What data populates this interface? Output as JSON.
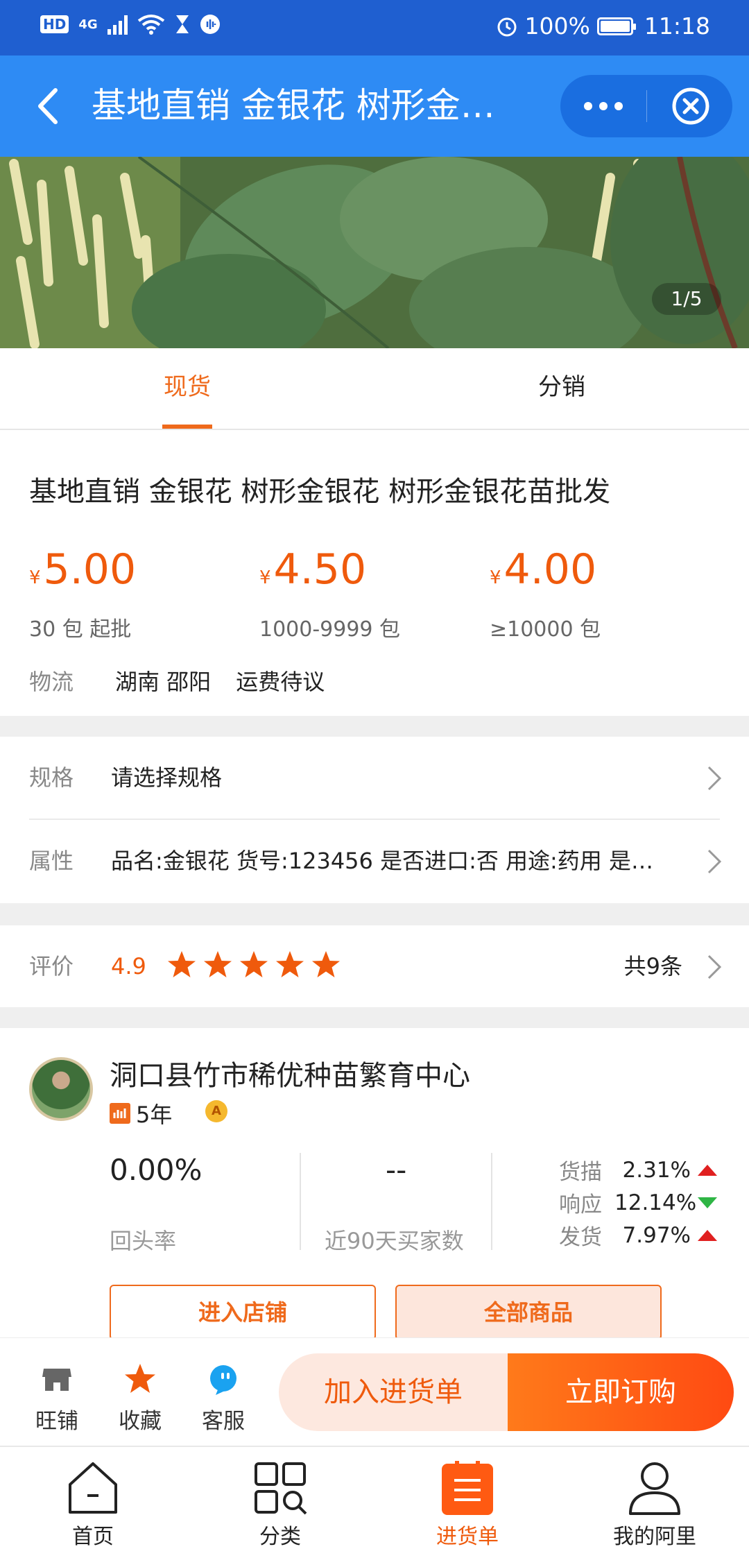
{
  "status_bar": {
    "badge": "HD",
    "network": "4G",
    "battery": "100%",
    "time": "11:18"
  },
  "header": {
    "title": "基地直销 金银花 树形金银花 树形金银花苗批发"
  },
  "gallery": {
    "counter": "1/5"
  },
  "tabs": [
    {
      "label": "现货",
      "active": true
    },
    {
      "label": "分销",
      "active": false
    }
  ],
  "product": {
    "title": "基地直销 金银花 树形金银花 树形金银花苗批发",
    "currency": "¥",
    "prices": [
      {
        "value": "5.00",
        "moq": "30 包 起批"
      },
      {
        "value": "4.50",
        "moq": "1000-9999 包"
      },
      {
        "value": "4.00",
        "moq": "≥10000 包"
      }
    ],
    "logistics": {
      "label": "物流",
      "origin": "湖南 邵阳",
      "freight": "运费待议"
    }
  },
  "spec": {
    "label": "规格",
    "value": "请选择规格"
  },
  "attrs": {
    "label": "属性",
    "value": "品名:金银花  货号:123456  是否进口:否  用途:药用  是…"
  },
  "reviews": {
    "label": "评价",
    "score": "4.9",
    "stars": 5,
    "count": "共9条"
  },
  "shop": {
    "name": "洞口县竹市稀优种苗繁育中心",
    "years": "5年",
    "badge": "A",
    "repeat_rate": "0.00%",
    "repeat_rate_label": "回头率",
    "buyers": "--",
    "buyers_label": "近90天买家数",
    "scores": [
      {
        "label": "货描",
        "value": "2.31%",
        "trend": "up"
      },
      {
        "label": "响应",
        "value": "12.14%",
        "trend": "down"
      },
      {
        "label": "发货",
        "value": "7.97%",
        "trend": "up"
      }
    ],
    "enter_button": "进入店铺",
    "all_goods_button": "全部商品"
  },
  "actions": {
    "shop": "旺铺",
    "favorite": "收藏",
    "service": "客服",
    "add_cart": "加入进货单",
    "buy_now": "立即订购"
  },
  "tabbar": [
    {
      "label": "首页",
      "icon": "home-icon"
    },
    {
      "label": "分类",
      "icon": "category-icon"
    },
    {
      "label": "进货单",
      "icon": "purchase-list-icon",
      "active": true
    },
    {
      "label": "我的阿里",
      "icon": "profile-icon"
    }
  ],
  "colors": {
    "accent": "#ef5a0c",
    "header": "#2e8bf4",
    "status": "#1f5fd0"
  }
}
